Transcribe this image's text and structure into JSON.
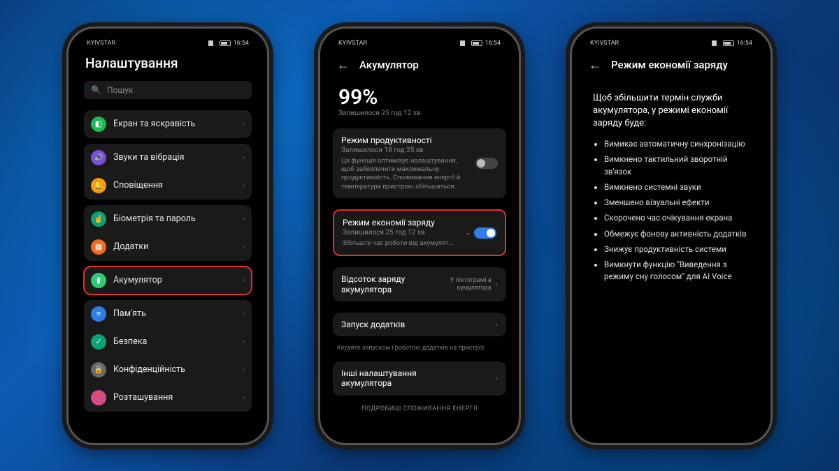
{
  "status": {
    "carrier": "KYIVSTAR",
    "time": "16:54"
  },
  "screen1": {
    "title": "Налаштування",
    "search_placeholder": "Пошук",
    "groups": [
      {
        "items": [
          {
            "icon": "ic-green",
            "glyph": "◧",
            "label": "Екран та яскравість"
          }
        ]
      },
      {
        "items": [
          {
            "icon": "ic-purple",
            "glyph": "🔊",
            "label": "Звуки та вібрація"
          },
          {
            "icon": "ic-orange",
            "glyph": "🔔",
            "label": "Сповіщення"
          }
        ]
      },
      {
        "items": [
          {
            "icon": "ic-teal",
            "glyph": "☝",
            "label": "Біометрія та пароль"
          },
          {
            "icon": "ic-orange2",
            "glyph": "▦",
            "label": "Додатки"
          }
        ]
      },
      {
        "highlight": true,
        "items": [
          {
            "icon": "ic-green2",
            "glyph": "▮",
            "label": "Акумулятор"
          }
        ]
      },
      {
        "items": [
          {
            "icon": "ic-blue",
            "glyph": "≡",
            "label": "Пам'ять"
          },
          {
            "icon": "ic-green3",
            "glyph": "✓",
            "label": "Безпека"
          },
          {
            "icon": "ic-gray",
            "glyph": "🔒",
            "label": "Конфіденційність"
          },
          {
            "icon": "ic-pink",
            "glyph": "📍",
            "label": "Розташування"
          }
        ]
      }
    ]
  },
  "screen2": {
    "title": "Акумулятор",
    "percent": "99%",
    "remaining": "Залишилося 25 год 12 хв",
    "perf": {
      "title": "Режим продуктивності",
      "sub": "Залишилося 18 год 25 хв",
      "desc": "Ця функція оптимізує налаштування, щоб забезпечити максимальну продуктивність. Споживання енергії й температура пристрою збільшаться.",
      "on": false
    },
    "saver": {
      "title": "Режим економії заряду",
      "sub": "Залишилося 25 год 12 хв",
      "desc": "Збільште час роботи від акумулят...",
      "on": true
    },
    "pct_row": {
      "label": "Відсоток заряду акумулятора",
      "value": "У піктограмі а кумулятора"
    },
    "launch": {
      "label": "Запуск додатків"
    },
    "launch_hint": "Керуйте запуском і роботою додатків на пристрої.",
    "more": {
      "label": "Інші налаштування акумулятора"
    },
    "section": "ПОДРОБИЦІ СПОЖИВАННЯ ЕНЕРГІЇ"
  },
  "screen3": {
    "title": "Режим економії заряду",
    "intro": "Щоб збільшити термін служби акумулятора, у режимі економії заряду буде:",
    "bullets": [
      "Вимикає автоматичну синхронізацію",
      "Вимкнено тактильний зворотній зв'язок",
      "Вимкнено системні звуки",
      "Зменшено візуальні ефекти",
      "Скорочено час очікування екрана",
      "Обмежує фонову активність додатків",
      "Знижує продуктивність системи",
      "Вимкнути функцію \"Виведення з режиму сну голосом\" для AI Voice"
    ]
  }
}
